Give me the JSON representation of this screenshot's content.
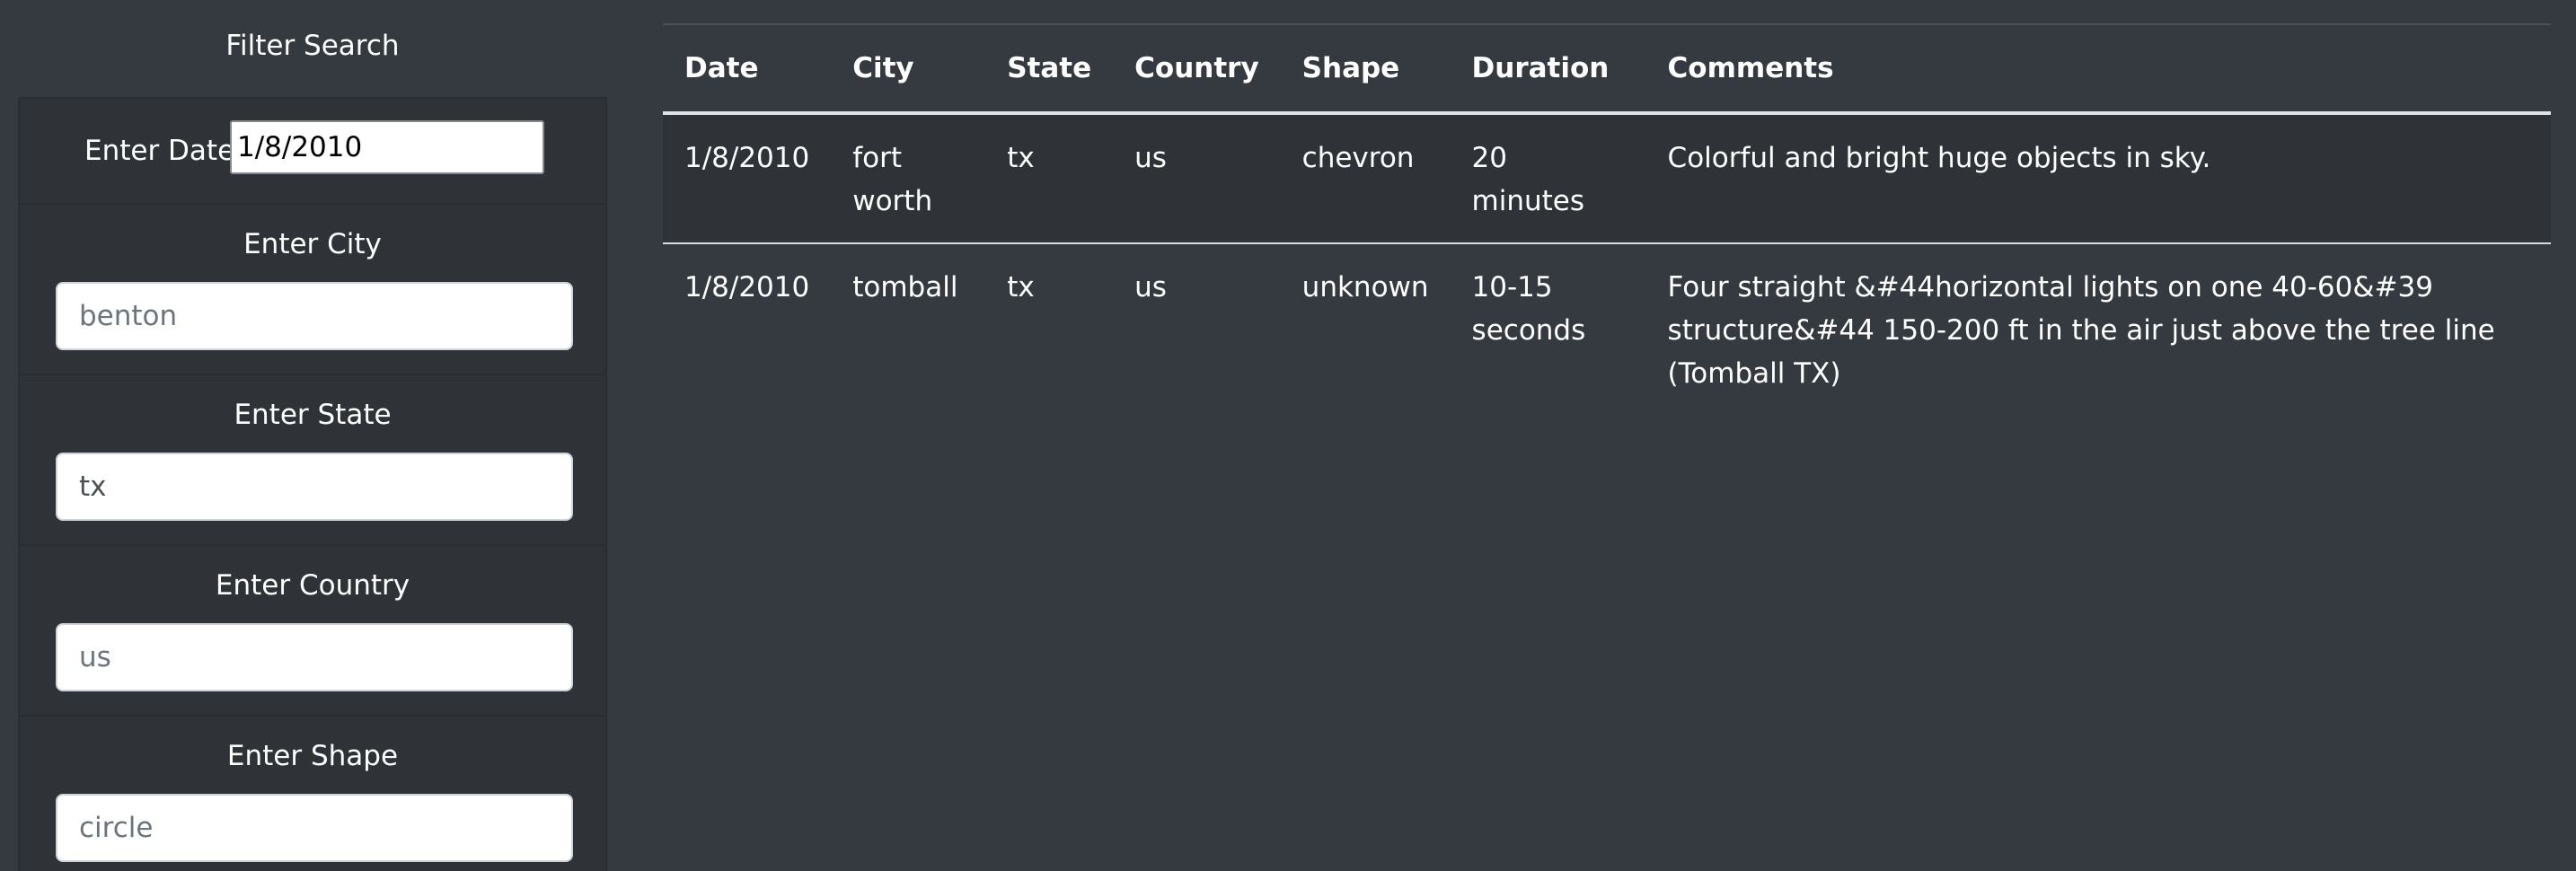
{
  "sidebar": {
    "title": "Filter Search",
    "date": {
      "label": "Enter Date",
      "value": "1/8/2010"
    },
    "city": {
      "label": "Enter City",
      "placeholder": "benton",
      "value": ""
    },
    "state": {
      "label": "Enter State",
      "placeholder": "",
      "value": "tx"
    },
    "country": {
      "label": "Enter Country",
      "placeholder": "us",
      "value": ""
    },
    "shape": {
      "label": "Enter Shape",
      "placeholder": "circle",
      "value": ""
    }
  },
  "table": {
    "headers": [
      "Date",
      "City",
      "State",
      "Country",
      "Shape",
      "Duration",
      "Comments"
    ],
    "rows": [
      {
        "date": "1/8/2010",
        "city": "fort worth",
        "state": "tx",
        "country": "us",
        "shape": "chevron",
        "duration": "20 minutes",
        "comments": "Colorful and bright huge objects in sky."
      },
      {
        "date": "1/8/2010",
        "city": "tomball",
        "state": "tx",
        "country": "us",
        "shape": "unknown",
        "duration": "10-15 seconds",
        "comments": "Four straight &#44horizontal lights on one 40-60&#39 structure&#44 150-200 ft in the air just above the tree line (Tomball TX)"
      }
    ]
  },
  "colors": {
    "page_background": "#353a41",
    "sidebar_background": "#2f3338",
    "text": "#ffffff"
  }
}
